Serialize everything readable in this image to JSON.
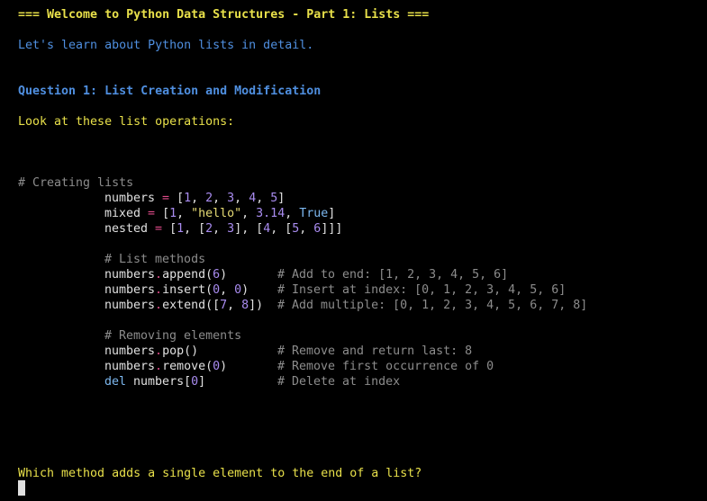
{
  "header": {
    "title": "=== Welcome to Python Data Structures - Part 1: Lists ===",
    "intro": "Let's learn about Python lists in detail."
  },
  "question": {
    "heading": "Question 1: List Creation and Modification",
    "prompt": "Look at these list operations:",
    "ask": "Which method adds a single element to the end of a list?"
  },
  "code": {
    "comment_creating": "# Creating lists",
    "numbers_line": [
      "numbers",
      " = ",
      "[",
      "1",
      ", ",
      "2",
      ", ",
      "3",
      ", ",
      "4",
      ", ",
      "5",
      "]"
    ],
    "mixed_line": [
      "mixed",
      " = ",
      "[",
      "1",
      ", ",
      "\"hello\"",
      ", ",
      "3.14",
      ", ",
      "True",
      "]"
    ],
    "nested_line": [
      "nested",
      " = ",
      "[",
      "1",
      ", [",
      "2",
      ", ",
      "3",
      "], [",
      "4",
      ", [",
      "5",
      ", ",
      "6",
      "]]]"
    ],
    "comment_methods": "# List methods",
    "append_line": {
      "obj": "numbers",
      "dot": ".",
      "method": "append(",
      "arg": "6",
      "close": ")",
      "comment": "# Add to end: [1, 2, 3, 4, 5, 6]"
    },
    "insert_line": {
      "obj": "numbers",
      "dot": ".",
      "method": "insert(",
      "arg1": "0",
      "sep": ", ",
      "arg2": "0",
      "close": ")",
      "comment": "# Insert at index: [0, 1, 2, 3, 4, 5, 6]"
    },
    "extend_line": {
      "obj": "numbers",
      "dot": ".",
      "method": "extend([",
      "arg1": "7",
      "sep": ", ",
      "arg2": "8",
      "close": "])",
      "comment": "# Add multiple: [0, 1, 2, 3, 4, 5, 6, 7, 8]"
    },
    "comment_removing": "# Removing elements",
    "pop_line": {
      "obj": "numbers",
      "dot": ".",
      "method": "pop()",
      "comment": "# Remove and return last: 8"
    },
    "remove_line": {
      "obj": "numbers",
      "dot": ".",
      "method": "remove(",
      "arg": "0",
      "close": ")",
      "comment": "# Remove first occurrence of 0"
    },
    "del_line": {
      "kw": "del",
      "obj": " numbers[",
      "arg": "0",
      "close": "]",
      "comment": "# Delete at index"
    }
  },
  "colors": {
    "background": "#000000",
    "yellow": "#e8e04a",
    "blue": "#4f8fe0",
    "comment": "#8c8c8c"
  }
}
